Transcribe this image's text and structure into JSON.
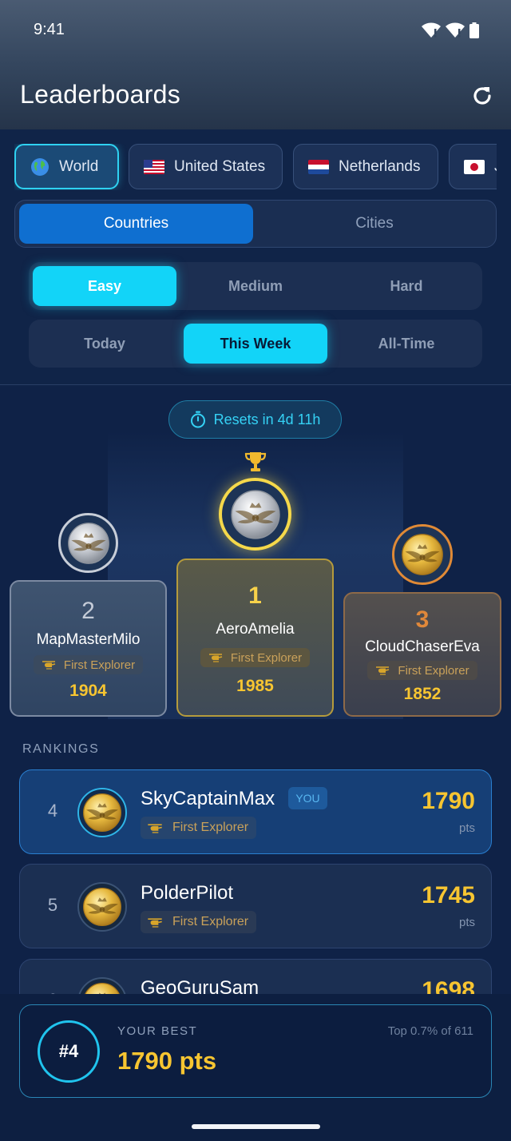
{
  "status": {
    "time": "9:41"
  },
  "header": {
    "title": "Leaderboards"
  },
  "regions": [
    {
      "label": "World",
      "flag": "🌍",
      "active": true
    },
    {
      "label": "United States",
      "flag": "us"
    },
    {
      "label": "Netherlands",
      "flag": "nl"
    },
    {
      "label": "J",
      "flag": "jp"
    }
  ],
  "scope": {
    "countries": "Countries",
    "cities": "Cities",
    "selected": "Countries"
  },
  "difficulty": {
    "easy": "Easy",
    "medium": "Medium",
    "hard": "Hard",
    "selected": "Easy"
  },
  "period": {
    "today": "Today",
    "week": "This Week",
    "alltime": "All-Time",
    "selected": "This Week"
  },
  "resets": "Resets in 4d 11h",
  "podium": {
    "first": {
      "rank": "1",
      "name": "AeroAmelia",
      "badge": "First Explorer",
      "score": "1985"
    },
    "second": {
      "rank": "2",
      "name": "MapMasterMilo",
      "badge": "First Explorer",
      "score": "1904"
    },
    "third": {
      "rank": "3",
      "name": "CloudChaserEva",
      "badge": "First Explorer",
      "score": "1852"
    }
  },
  "rankings_label": "RANKINGS",
  "rankings": [
    {
      "rank": "4",
      "name": "SkyCaptainMax",
      "you": "YOU",
      "badge": "First Explorer",
      "score": "1790",
      "unit": "pts"
    },
    {
      "rank": "5",
      "name": "PolderPilot",
      "badge": "First Explorer",
      "score": "1745",
      "unit": "pts"
    },
    {
      "rank": "6",
      "name": "GeoGuruSam",
      "score": "1698"
    }
  ],
  "best": {
    "position": "#4",
    "label": "YOUR BEST",
    "score": "1790 pts",
    "top": "Top 0.7% of 611"
  },
  "colors": {
    "accent": "#12d4f8",
    "gold": "#f7c531",
    "primary": "#0f6fd0",
    "background": "#0f2247"
  }
}
